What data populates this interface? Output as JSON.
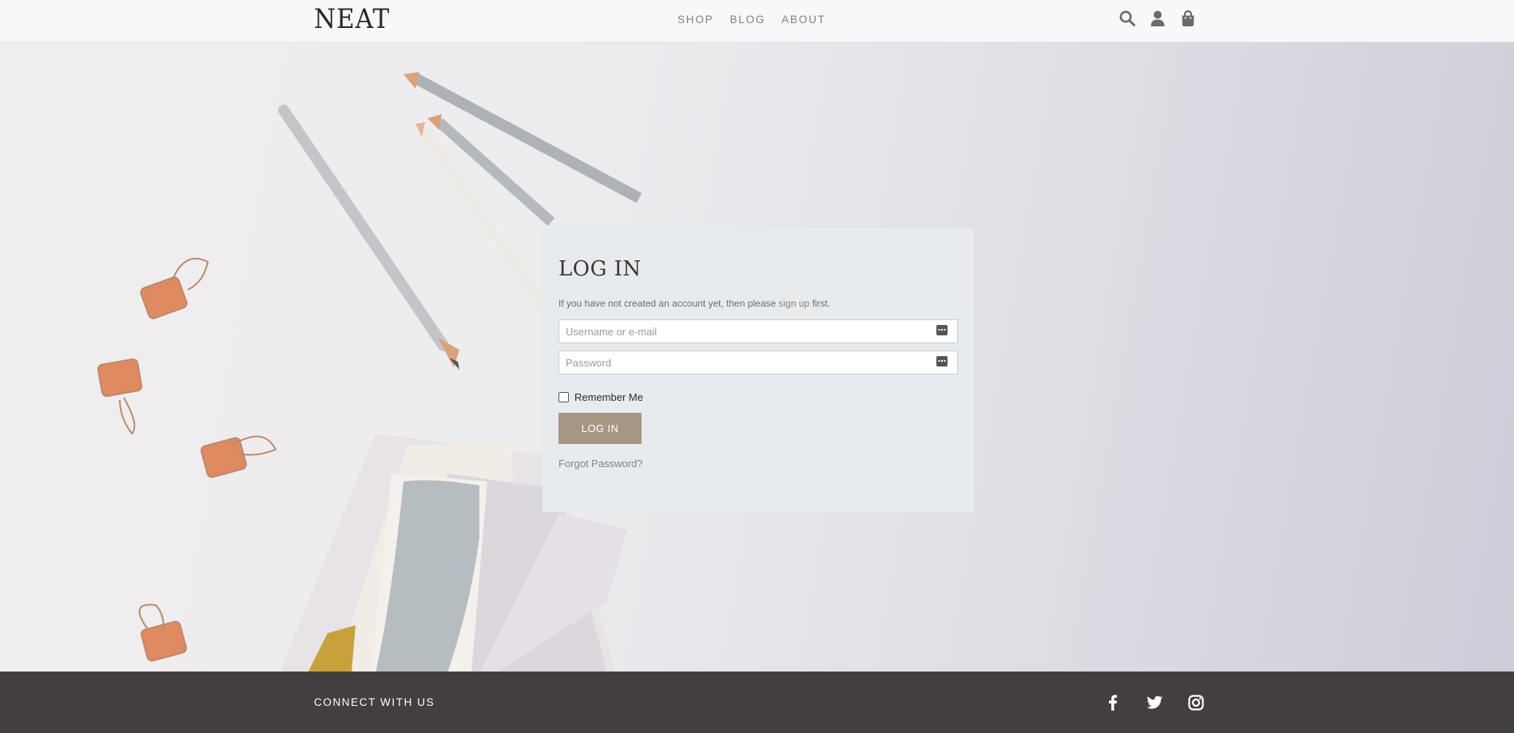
{
  "header": {
    "logo": "NEAT",
    "nav": [
      {
        "label": "SHOP"
      },
      {
        "label": "BLOG"
      },
      {
        "label": "ABOUT"
      }
    ],
    "icons": [
      "search-icon",
      "user-icon",
      "shopping-bag-icon"
    ]
  },
  "login": {
    "title": "LOG IN",
    "info_prefix": "If you have not created an account yet, then please",
    "signup_link": "sign up",
    "info_suffix": "first.",
    "username_placeholder": "Username or e-mail",
    "password_placeholder": "Password",
    "remember_label": "Remember Me",
    "remember_checked": false,
    "submit_label": "LOG IN",
    "forgot_label": "Forgot Password?"
  },
  "footer": {
    "connect_label": "CONNECT WITH US",
    "social_icons": [
      "facebook-icon",
      "twitter-icon",
      "instagram-icon"
    ]
  },
  "colors": {
    "accent": "#a89685",
    "link": "#9a7c68",
    "footer_bg": "#433e3f",
    "header_bg": "#f7f8fa",
    "card_bg": "#e8ebee"
  }
}
